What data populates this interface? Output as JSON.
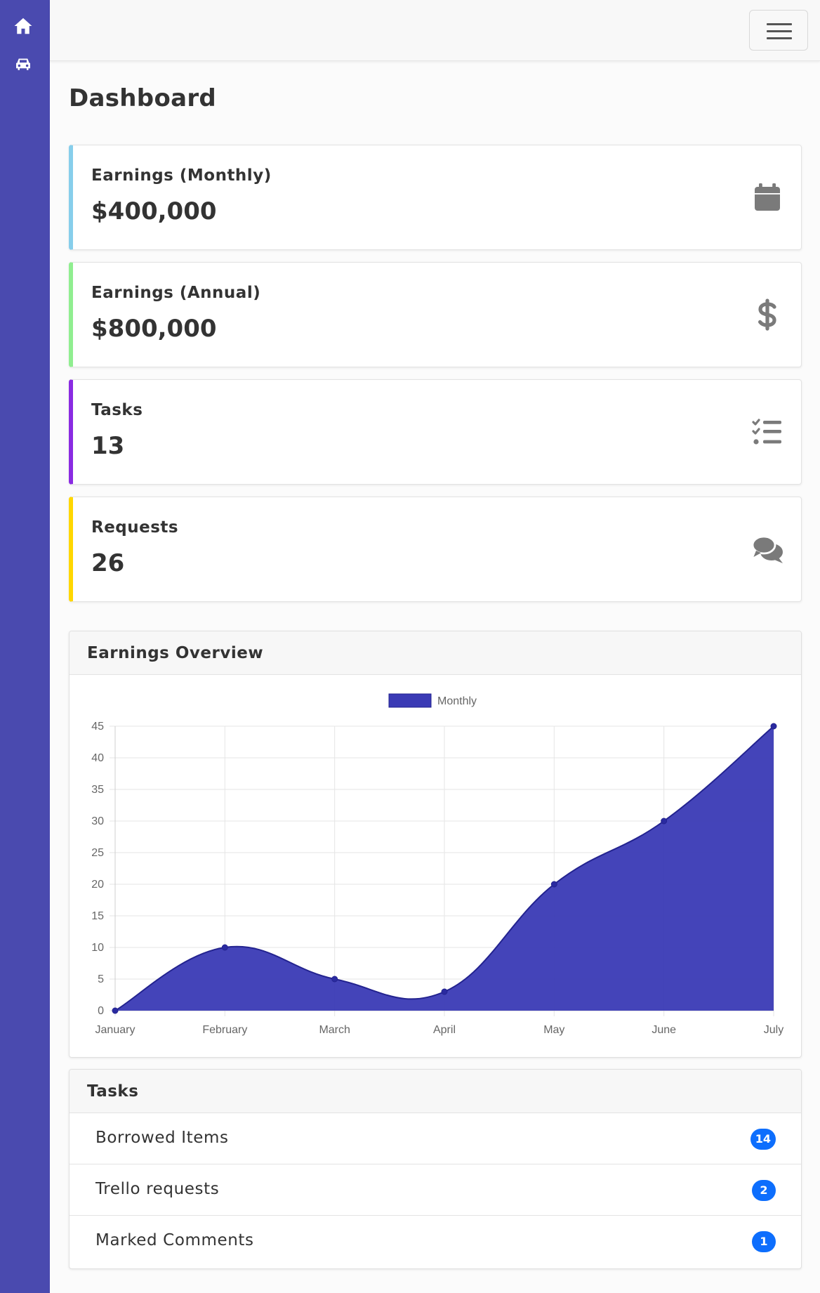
{
  "sidebar": {
    "items": [
      {
        "icon": "home-icon"
      },
      {
        "icon": "car-icon"
      }
    ]
  },
  "topbar": {
    "toggler_icon": "hamburger-menu-icon"
  },
  "page": {
    "title": "Dashboard"
  },
  "stats": [
    {
      "label": "Earnings (Monthly)",
      "value": "$400,000",
      "accent": "#87CEEB",
      "icon": "calendar-icon"
    },
    {
      "label": "Earnings (Annual)",
      "value": "$800,000",
      "accent": "#90EE90",
      "icon": "dollar-icon"
    },
    {
      "label": "Tasks",
      "value": "13",
      "accent": "#8A2BE2",
      "icon": "task-list-icon"
    },
    {
      "label": "Requests",
      "value": "26",
      "accent": "#FFD700",
      "icon": "comments-icon"
    }
  ],
  "overview": {
    "title": "Earnings Overview"
  },
  "chart_data": {
    "type": "area",
    "categories": [
      "January",
      "February",
      "March",
      "April",
      "May",
      "June",
      "July"
    ],
    "series": [
      {
        "name": "Monthly",
        "values": [
          0,
          10,
          5,
          3,
          20,
          30,
          45
        ],
        "color": "#3a3ab5"
      }
    ],
    "ylim": [
      0,
      45
    ],
    "yticks": [
      0,
      5,
      10,
      15,
      20,
      25,
      30,
      35,
      40,
      45
    ],
    "grid": true,
    "legend_position": "top-center"
  },
  "tasks": {
    "title": "Tasks",
    "items": [
      {
        "label": "Borrowed Items",
        "count": "14"
      },
      {
        "label": "Trello requests",
        "count": "2"
      },
      {
        "label": "Marked Comments",
        "count": "1"
      }
    ]
  },
  "colors": {
    "sidebar": "#4a4aaf",
    "badge": "#0d6efd",
    "icon_gray": "#7a7a7a"
  }
}
